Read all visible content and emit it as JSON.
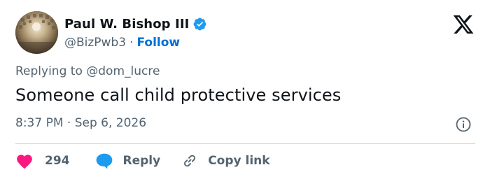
{
  "author": {
    "display_name": "Paul W. Bishop III",
    "handle": "@BizPwb3",
    "separator": "·",
    "follow_label": "Follow",
    "avatar_icon": "pantheon-dome-photo",
    "verified_icon": "verified-badge-icon"
  },
  "tweet": {
    "replying_prefix": "Replying to",
    "replying_to": "@dom_lucre",
    "text": "Someone call child protective services",
    "timestamp": "8:37 PM · Sep 6, 2026"
  },
  "actions": {
    "like_count": "294",
    "reply_label": "Reply",
    "copy_label": "Copy link"
  },
  "icons": {
    "brand": "x-logo-icon",
    "info": "info-icon",
    "like": "heart-icon",
    "reply": "speech-bubble-icon",
    "copy": "link-icon"
  },
  "colors": {
    "text": "#0f1419",
    "secondary": "#536471",
    "link": "#006fd6",
    "verified": "#1d9bf0",
    "like": "#f91880",
    "reply": "#1d9bf0",
    "divider": "#cfd9de"
  }
}
